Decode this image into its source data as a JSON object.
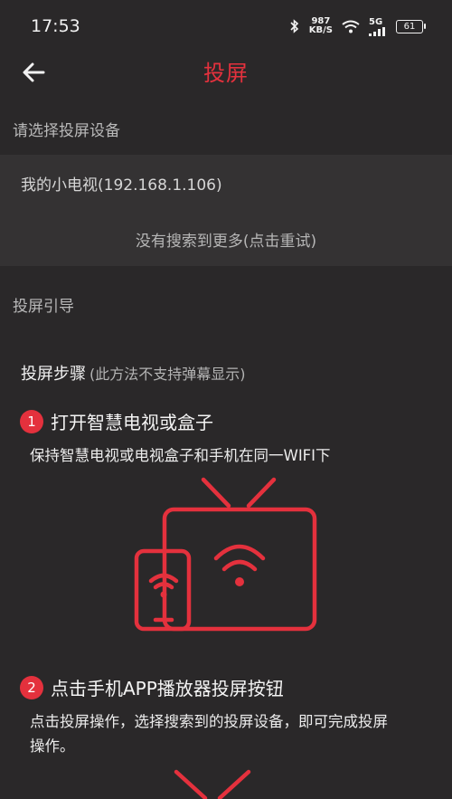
{
  "status_bar": {
    "time": "17:53",
    "net_speed_value": "987",
    "net_speed_unit": "KB/S",
    "signal_label": "5G",
    "battery": "61"
  },
  "header": {
    "title": "投屏",
    "back_icon": "arrow-left-icon"
  },
  "devices": {
    "section_label": "请选择投屏设备",
    "items": [
      {
        "name": "我的小电视(192.168.1.106)"
      }
    ],
    "retry_text": "没有搜索到更多(点击重试)"
  },
  "guide": {
    "section_label": "投屏引导",
    "steps_title": "投屏步骤",
    "steps_note": "(此方法不支持弹幕显示)",
    "steps": [
      {
        "number": "1",
        "title": "打开智慧电视或盒子",
        "desc": "保持智慧电视或电视盒子和手机在同一WIFI下"
      },
      {
        "number": "2",
        "title": "点击手机APP播放器投屏按钮",
        "desc": "点击投屏操作，选择搜索到的投屏设备，即可完成投屏操作。"
      }
    ]
  },
  "colors": {
    "accent": "#e4313d",
    "background": "#2a2829",
    "panel": "#343233"
  }
}
